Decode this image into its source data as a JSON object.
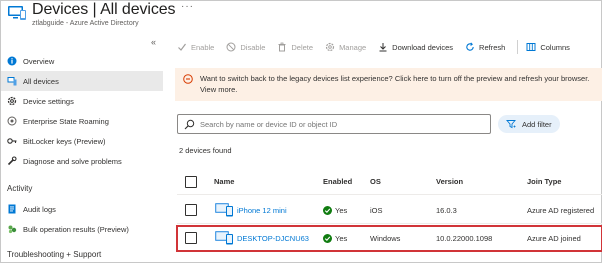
{
  "header": {
    "title": "Devices | All devices",
    "subtitle": "ztlabguide - Azure Active Directory",
    "more": "···"
  },
  "sidebar": {
    "collapse": "«",
    "items": [
      {
        "label": "Overview",
        "icon": "info-icon"
      },
      {
        "label": "All devices",
        "icon": "devices-icon",
        "active": true
      },
      {
        "label": "Device settings",
        "icon": "gear-icon"
      },
      {
        "label": "Enterprise State Roaming",
        "icon": "roaming-icon"
      },
      {
        "label": "BitLocker keys (Preview)",
        "icon": "key-icon"
      },
      {
        "label": "Diagnose and solve problems",
        "icon": "wrench-icon"
      }
    ],
    "activity_heading": "Activity",
    "activity_items": [
      {
        "label": "Audit logs",
        "icon": "audit-log-icon"
      },
      {
        "label": "Bulk operation results (Preview)",
        "icon": "bulk-operation-icon"
      }
    ],
    "support_heading": "Troubleshooting + Support"
  },
  "toolbar": {
    "enable": "Enable",
    "disable": "Disable",
    "delete": "Delete",
    "manage": "Manage",
    "download": "Download devices",
    "refresh": "Refresh",
    "columns": "Columns"
  },
  "banner": {
    "text": "Want to switch back to the legacy devices list experience? Click here to turn off the preview and refresh your browser. View more."
  },
  "search": {
    "placeholder": "Search by name or device ID or object ID",
    "filter_label": "Add filter"
  },
  "count_text": "2 devices found",
  "table": {
    "columns": [
      "Name",
      "Enabled",
      "OS",
      "Version",
      "Join Type"
    ],
    "rows": [
      {
        "name": "iPhone 12 mini",
        "enabled": "Yes",
        "os": "iOS",
        "version": "16.0.3",
        "join_type": "Azure AD registered",
        "highlighted": false
      },
      {
        "name": "DESKTOP-DJCNU63",
        "enabled": "Yes",
        "os": "Windows",
        "version": "10.0.22000.1098",
        "join_type": "Azure AD joined",
        "highlighted": true
      }
    ]
  },
  "colors": {
    "accent": "#0078d4",
    "success": "#107c10",
    "warning_banner": "#fdf0e5",
    "highlight_border": "#d13438"
  }
}
